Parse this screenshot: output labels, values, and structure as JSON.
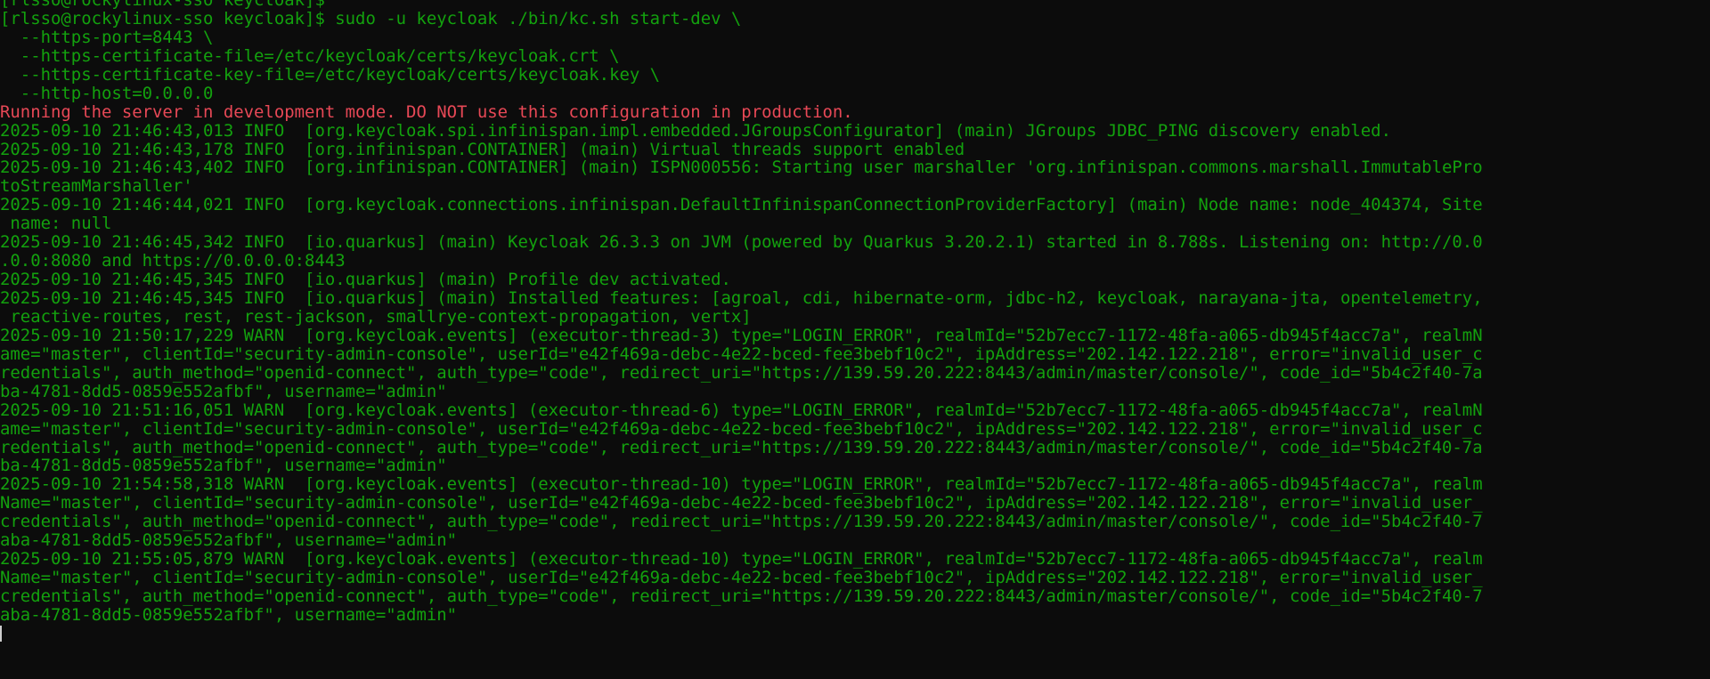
{
  "terminal": {
    "colors": {
      "background": "#0c0c0c",
      "text": "#13a10e",
      "warning": "#e74856",
      "cursor": "#cccccc"
    },
    "lines": [
      {
        "text": "[rlsso@rockylinux-sso keycloak]$",
        "style": "normal"
      },
      {
        "text": "[rlsso@rockylinux-sso keycloak]$ sudo -u keycloak ./bin/kc.sh start-dev \\",
        "style": "normal"
      },
      {
        "text": "  --https-port=8443 \\",
        "style": "normal"
      },
      {
        "text": "  --https-certificate-file=/etc/keycloak/certs/keycloak.crt \\",
        "style": "normal"
      },
      {
        "text": "  --https-certificate-key-file=/etc/keycloak/certs/keycloak.key \\",
        "style": "normal"
      },
      {
        "text": "  --http-host=0.0.0.0",
        "style": "normal"
      },
      {
        "text": "Running the server in development mode. DO NOT use this configuration in production.",
        "style": "warning"
      },
      {
        "text": "2025-09-10 21:46:43,013 INFO  [org.keycloak.spi.infinispan.impl.embedded.JGroupsConfigurator] (main) JGroups JDBC_PING discovery enabled.",
        "style": "normal"
      },
      {
        "text": "2025-09-10 21:46:43,178 INFO  [org.infinispan.CONTAINER] (main) Virtual threads support enabled",
        "style": "normal"
      },
      {
        "text": "2025-09-10 21:46:43,402 INFO  [org.infinispan.CONTAINER] (main) ISPN000556: Starting user marshaller 'org.infinispan.commons.marshall.ImmutablePro",
        "style": "normal"
      },
      {
        "text": "toStreamMarshaller'",
        "style": "normal"
      },
      {
        "text": "2025-09-10 21:46:44,021 INFO  [org.keycloak.connections.infinispan.DefaultInfinispanConnectionProviderFactory] (main) Node name: node_404374, Site",
        "style": "normal"
      },
      {
        "text": " name: null",
        "style": "normal"
      },
      {
        "text": "2025-09-10 21:46:45,342 INFO  [io.quarkus] (main) Keycloak 26.3.3 on JVM (powered by Quarkus 3.20.2.1) started in 8.788s. Listening on: http://0.0",
        "style": "normal"
      },
      {
        "text": ".0.0:8080 and https://0.0.0.0:8443",
        "style": "normal"
      },
      {
        "text": "2025-09-10 21:46:45,345 INFO  [io.quarkus] (main) Profile dev activated.",
        "style": "normal"
      },
      {
        "text": "2025-09-10 21:46:45,345 INFO  [io.quarkus] (main) Installed features: [agroal, cdi, hibernate-orm, jdbc-h2, keycloak, narayana-jta, opentelemetry,",
        "style": "normal"
      },
      {
        "text": " reactive-routes, rest, rest-jackson, smallrye-context-propagation, vertx]",
        "style": "normal"
      },
      {
        "text": "2025-09-10 21:50:17,229 WARN  [org.keycloak.events] (executor-thread-3) type=\"LOGIN_ERROR\", realmId=\"52b7ecc7-1172-48fa-a065-db945f4acc7a\", realmN",
        "style": "normal"
      },
      {
        "text": "ame=\"master\", clientId=\"security-admin-console\", userId=\"e42f469a-debc-4e22-bced-fee3bebf10c2\", ipAddress=\"202.142.122.218\", error=\"invalid_user_c",
        "style": "normal"
      },
      {
        "text": "redentials\", auth_method=\"openid-connect\", auth_type=\"code\", redirect_uri=\"https://139.59.20.222:8443/admin/master/console/\", code_id=\"5b4c2f40-7a",
        "style": "normal"
      },
      {
        "text": "ba-4781-8dd5-0859e552afbf\", username=\"admin\"",
        "style": "normal"
      },
      {
        "text": "2025-09-10 21:51:16,051 WARN  [org.keycloak.events] (executor-thread-6) type=\"LOGIN_ERROR\", realmId=\"52b7ecc7-1172-48fa-a065-db945f4acc7a\", realmN",
        "style": "normal"
      },
      {
        "text": "ame=\"master\", clientId=\"security-admin-console\", userId=\"e42f469a-debc-4e22-bced-fee3bebf10c2\", ipAddress=\"202.142.122.218\", error=\"invalid_user_c",
        "style": "normal"
      },
      {
        "text": "redentials\", auth_method=\"openid-connect\", auth_type=\"code\", redirect_uri=\"https://139.59.20.222:8443/admin/master/console/\", code_id=\"5b4c2f40-7a",
        "style": "normal"
      },
      {
        "text": "ba-4781-8dd5-0859e552afbf\", username=\"admin\"",
        "style": "normal"
      },
      {
        "text": "2025-09-10 21:54:58,318 WARN  [org.keycloak.events] (executor-thread-10) type=\"LOGIN_ERROR\", realmId=\"52b7ecc7-1172-48fa-a065-db945f4acc7a\", realm",
        "style": "normal"
      },
      {
        "text": "Name=\"master\", clientId=\"security-admin-console\", userId=\"e42f469a-debc-4e22-bced-fee3bebf10c2\", ipAddress=\"202.142.122.218\", error=\"invalid_user_",
        "style": "normal"
      },
      {
        "text": "credentials\", auth_method=\"openid-connect\", auth_type=\"code\", redirect_uri=\"https://139.59.20.222:8443/admin/master/console/\", code_id=\"5b4c2f40-7",
        "style": "normal"
      },
      {
        "text": "aba-4781-8dd5-0859e552afbf\", username=\"admin\"",
        "style": "normal"
      },
      {
        "text": "2025-09-10 21:55:05,879 WARN  [org.keycloak.events] (executor-thread-10) type=\"LOGIN_ERROR\", realmId=\"52b7ecc7-1172-48fa-a065-db945f4acc7a\", realm",
        "style": "normal"
      },
      {
        "text": "Name=\"master\", clientId=\"security-admin-console\", userId=\"e42f469a-debc-4e22-bced-fee3bebf10c2\", ipAddress=\"202.142.122.218\", error=\"invalid_user_",
        "style": "normal"
      },
      {
        "text": "credentials\", auth_method=\"openid-connect\", auth_type=\"code\", redirect_uri=\"https://139.59.20.222:8443/admin/master/console/\", code_id=\"5b4c2f40-7",
        "style": "normal"
      },
      {
        "text": "aba-4781-8dd5-0859e552afbf\", username=\"admin\"",
        "style": "normal"
      }
    ]
  }
}
